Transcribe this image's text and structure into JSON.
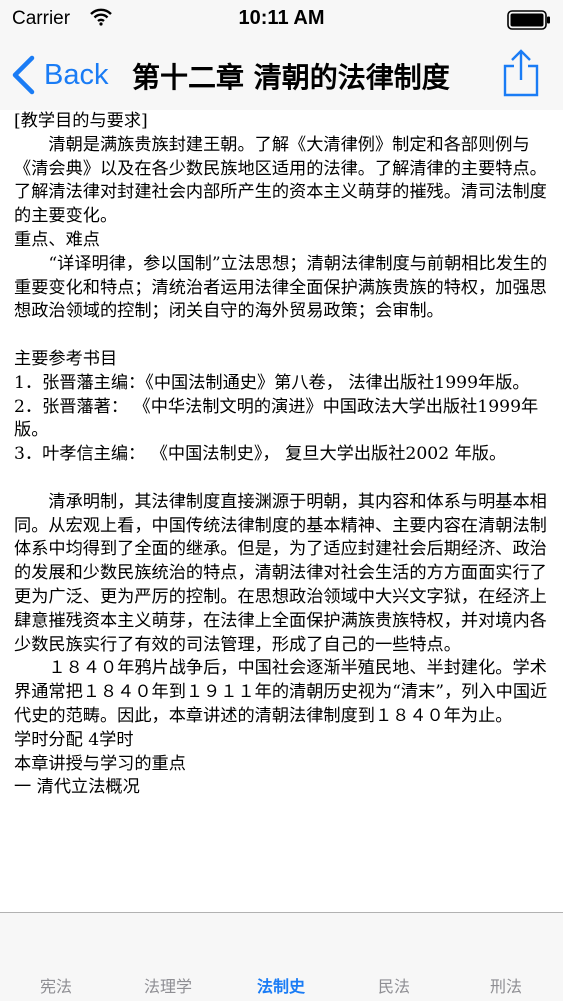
{
  "status_bar": {
    "carrier": "Carrier",
    "time": "10:11 AM"
  },
  "nav": {
    "back_label": "Back",
    "title": "第十二章 清朝的法律制度"
  },
  "content": {
    "lines": [
      "[教学目的与要求]",
      "清朝是满族贵族封建王朝。了解《大清律例》制定和各部则例与《清会典》以及在各少数民族地区适用的法律。了解清律的主要特点。了解清法律对封建社会内部所产生的资本主义萌芽的摧残。清司法制度的主要变化。",
      "重点、难点",
      "“详译明律，参以国制”立法思想；清朝法律制度与前朝相比发生的重要变化和特点；清统治者运用法律全面保护满族贵族的特权，加强思想政治领域的控制；闭关自守的海外贸易政策；会审制。",
      "",
      "主要参考书目",
      " 1．张晋藩主编：《中国法制通史》第八卷， 法律出版社1999年版。",
      " 2．张晋藩著： 《中华法制文明的演进》中国政法大学出版社1999年版。",
      " 3．叶孝信主编： 《中国法制史》， 复旦大学出版社2002 年版。",
      "",
      "清承明制，其法律制度直接渊源于明朝，其内容和体系与明基本相同。从宏观上看，中国传统法律制度的基本精神、主要内容在清朝法制体系中均得到了全面的继承。但是，为了适应封建社会后期经济、政治的发展和少数民族统治的特点，清朝法律对社会生活的方方面面实行了更为广泛、更为严厉的控制。在思想政治领域中大兴文字狱，在经济上肆意摧残资本主义萌芽，在法律上全面保护满族贵族特权，并对境内各少数民族实行了有效的司法管理，形成了自己的一些特点。",
      "１８４０年鸦片战争后，中国社会逐渐半殖民地、半封建化。学术界通常把１８４０年到１９１１年的清朝历史视为“清末”，列入中国近代史的范畴。因此，本章讲述的清朝法律制度到１８４０年为止。",
      "学时分配 4学时",
      "本章讲授与学习的重点",
      "一 清代立法概况"
    ]
  },
  "tabs": [
    {
      "label": "宪法"
    },
    {
      "label": "法理学"
    },
    {
      "label": "法制史"
    },
    {
      "label": "民法"
    },
    {
      "label": "刑法"
    }
  ],
  "colors": {
    "accent": "#1a7cf5",
    "tab_inactive": "#8e8e93"
  },
  "icons": {
    "wifi": "wifi-icon",
    "battery": "battery-icon",
    "back": "chevron-left-icon",
    "share": "share-icon"
  }
}
